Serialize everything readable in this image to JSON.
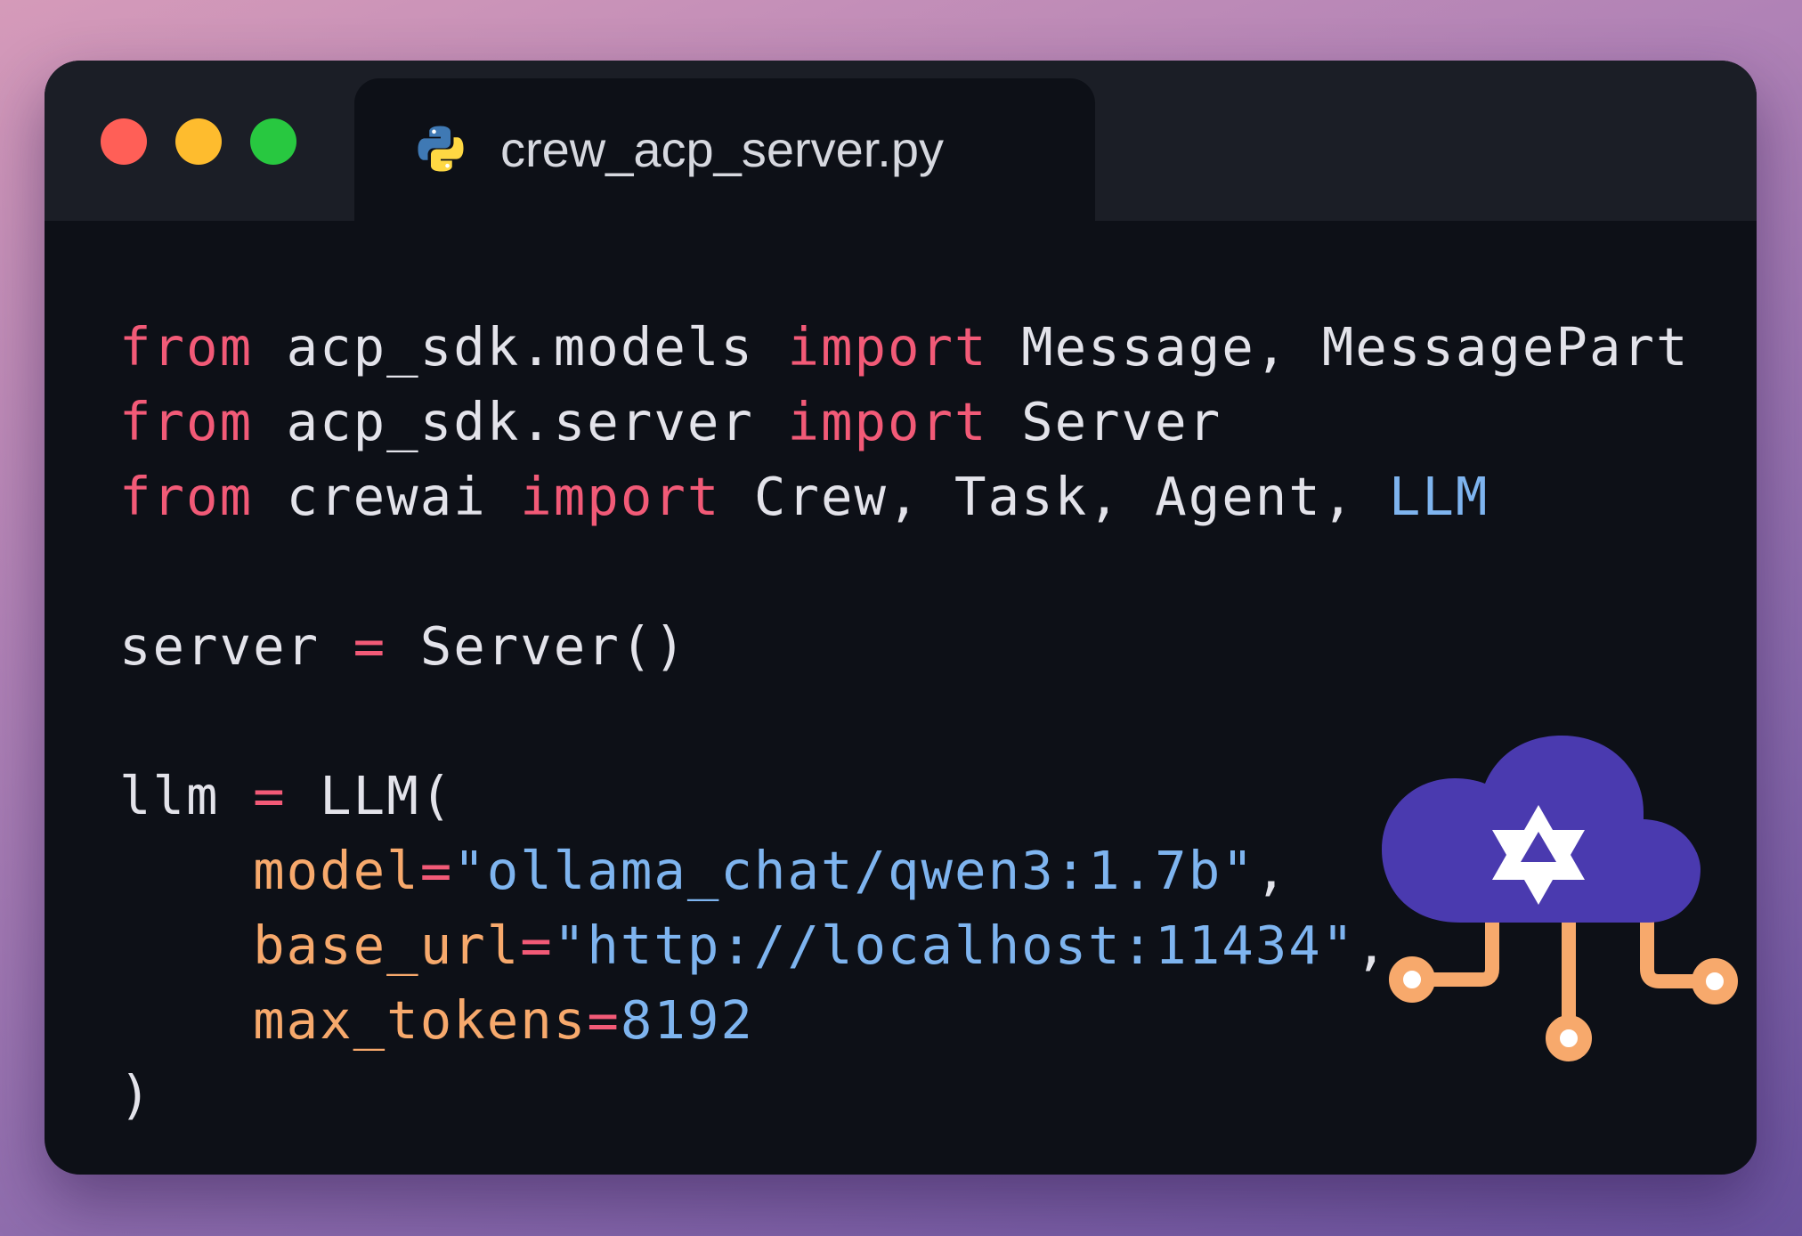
{
  "window": {
    "tab": {
      "filename": "crew_acp_server.py",
      "icon": "python-icon"
    },
    "controls": [
      "close",
      "minimize",
      "maximize"
    ]
  },
  "code": {
    "language": "python",
    "lines": [
      [
        {
          "t": "from",
          "k": "kw"
        },
        {
          "t": " acp_sdk.models ",
          "k": "txt"
        },
        {
          "t": "import",
          "k": "kw"
        },
        {
          "t": " Message, MessagePart",
          "k": "txt"
        }
      ],
      [
        {
          "t": "from",
          "k": "kw"
        },
        {
          "t": " acp_sdk.server ",
          "k": "txt"
        },
        {
          "t": "import",
          "k": "kw"
        },
        {
          "t": " Server",
          "k": "txt"
        }
      ],
      [
        {
          "t": "from",
          "k": "kw"
        },
        {
          "t": " crewai ",
          "k": "txt"
        },
        {
          "t": "import",
          "k": "kw"
        },
        {
          "t": " Crew, Task, Agent, ",
          "k": "txt"
        },
        {
          "t": "LLM",
          "k": "cls"
        }
      ],
      [],
      [
        {
          "t": "server ",
          "k": "txt"
        },
        {
          "t": "=",
          "k": "op"
        },
        {
          "t": " Server()",
          "k": "txt"
        }
      ],
      [],
      [
        {
          "t": "llm ",
          "k": "txt"
        },
        {
          "t": "=",
          "k": "op"
        },
        {
          "t": " LLM(",
          "k": "txt"
        }
      ],
      [
        {
          "t": "    ",
          "k": "txt"
        },
        {
          "t": "model",
          "k": "param"
        },
        {
          "t": "=",
          "k": "op"
        },
        {
          "t": "\"ollama_chat/qwen3:1.7b\"",
          "k": "str"
        },
        {
          "t": ",",
          "k": "txt"
        }
      ],
      [
        {
          "t": "    ",
          "k": "txt"
        },
        {
          "t": "base_url",
          "k": "param"
        },
        {
          "t": "=",
          "k": "op"
        },
        {
          "t": "\"http://localhost:11434\"",
          "k": "str"
        },
        {
          "t": ",",
          "k": "txt"
        }
      ],
      [
        {
          "t": "    ",
          "k": "txt"
        },
        {
          "t": "max_tokens",
          "k": "param"
        },
        {
          "t": "=",
          "k": "op"
        },
        {
          "t": "8192",
          "k": "num"
        }
      ],
      [
        {
          "t": ")",
          "k": "txt"
        }
      ]
    ]
  },
  "logo": {
    "icon": "qwen-cloud-icon",
    "colors": {
      "cloud": "#4a3aaf",
      "circuit": "#f7a96c"
    }
  },
  "colors": {
    "keyword": "#f25a77",
    "string": "#7eb4ef",
    "param": "#f7a96c",
    "text": "#e3e3ea",
    "background": "#0d1017"
  }
}
